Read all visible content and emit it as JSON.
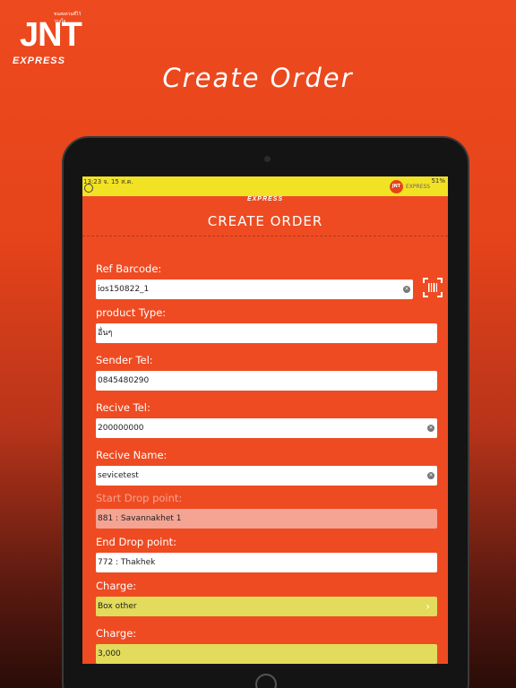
{
  "brand": {
    "tagline": "ขนส่งด่วนที่ไว้วางใจ",
    "logo": "JNT",
    "logo_sub": "EXPRESS"
  },
  "headline": "Create Order",
  "device": {
    "status": {
      "time": "13:23",
      "date": "จ. 15 ส.ค.",
      "right": "51%"
    },
    "mini_logo": "JNT",
    "mini_text": "EXPRESS"
  },
  "app": {
    "header_brand": "EXPRESS",
    "title": "CREATE ORDER",
    "fields": {
      "ref_barcode": {
        "label": "Ref Barcode:",
        "value": "ios150822_1"
      },
      "product_type": {
        "label": "product Type:",
        "value": "อื่นๆ"
      },
      "sender_tel": {
        "label": "Sender Tel:",
        "value": "0845480290"
      },
      "recive_tel": {
        "label": "Recive Tel:",
        "value": "200000000"
      },
      "recive_name": {
        "label": "Recive Name:",
        "value": "sevicetest"
      },
      "start_drop": {
        "label": "Start Drop point:",
        "value": "881 : Savannakhet 1"
      },
      "end_drop": {
        "label": "End Drop point:",
        "value": "772 : Thakhek"
      },
      "charge_type": {
        "label": "Charge:",
        "value": "Box other"
      },
      "charge_amount": {
        "label": "Charge:",
        "value": "3,000"
      }
    }
  },
  "colors": {
    "background": "#ee4a1f",
    "status_bar": "#f2e224",
    "select_field": "#e2db5b",
    "disabled_field": "#f5a493"
  },
  "icons": [
    "scan-barcode-icon",
    "clear-icon",
    "chevron-right-icon",
    "back-icon"
  ]
}
